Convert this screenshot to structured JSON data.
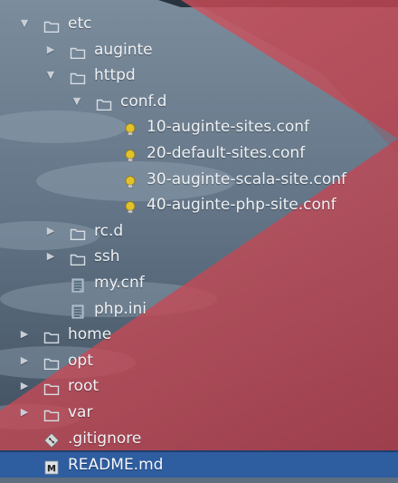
{
  "file_tree": {
    "items": [
      {
        "label": "etc",
        "kind": "folder",
        "state": "expanded",
        "depth": 0
      },
      {
        "label": "auginte",
        "kind": "folder",
        "state": "collapsed",
        "depth": 1
      },
      {
        "label": "httpd",
        "kind": "folder",
        "state": "expanded",
        "depth": 1
      },
      {
        "label": "conf.d",
        "kind": "folder",
        "state": "expanded",
        "depth": 2
      },
      {
        "label": "10-auginte-sites.conf",
        "kind": "conf",
        "state": "leaf",
        "depth": 3
      },
      {
        "label": "20-default-sites.conf",
        "kind": "conf",
        "state": "leaf",
        "depth": 3
      },
      {
        "label": "30-auginte-scala-site.conf",
        "kind": "conf",
        "state": "leaf",
        "depth": 3
      },
      {
        "label": "40-auginte-php-site.conf",
        "kind": "conf",
        "state": "leaf",
        "depth": 3
      },
      {
        "label": "rc.d",
        "kind": "folder",
        "state": "collapsed",
        "depth": 1
      },
      {
        "label": "ssh",
        "kind": "folder",
        "state": "collapsed",
        "depth": 1
      },
      {
        "label": "my.cnf",
        "kind": "ini",
        "state": "leaf",
        "depth": 1
      },
      {
        "label": "php.ini",
        "kind": "ini",
        "state": "leaf",
        "depth": 1
      },
      {
        "label": "home",
        "kind": "folder",
        "state": "collapsed",
        "depth": 0
      },
      {
        "label": "opt",
        "kind": "folder",
        "state": "collapsed",
        "depth": 0
      },
      {
        "label": "root",
        "kind": "folder",
        "state": "collapsed",
        "depth": 0
      },
      {
        "label": "var",
        "kind": "folder",
        "state": "collapsed",
        "depth": 0
      },
      {
        "label": ".gitignore",
        "kind": "git",
        "state": "leaf",
        "depth": 0
      },
      {
        "label": "README.md",
        "kind": "markdown",
        "state": "leaf",
        "depth": 0,
        "selected": true
      }
    ]
  },
  "colors": {
    "selection": "#2e5da0",
    "text": "#eef1f4",
    "folder_outline": "#d8dde3",
    "conf_bulb": "#e2c22a",
    "git_badge": "#dcdcdc",
    "red_overlay": "#cf4a55"
  }
}
